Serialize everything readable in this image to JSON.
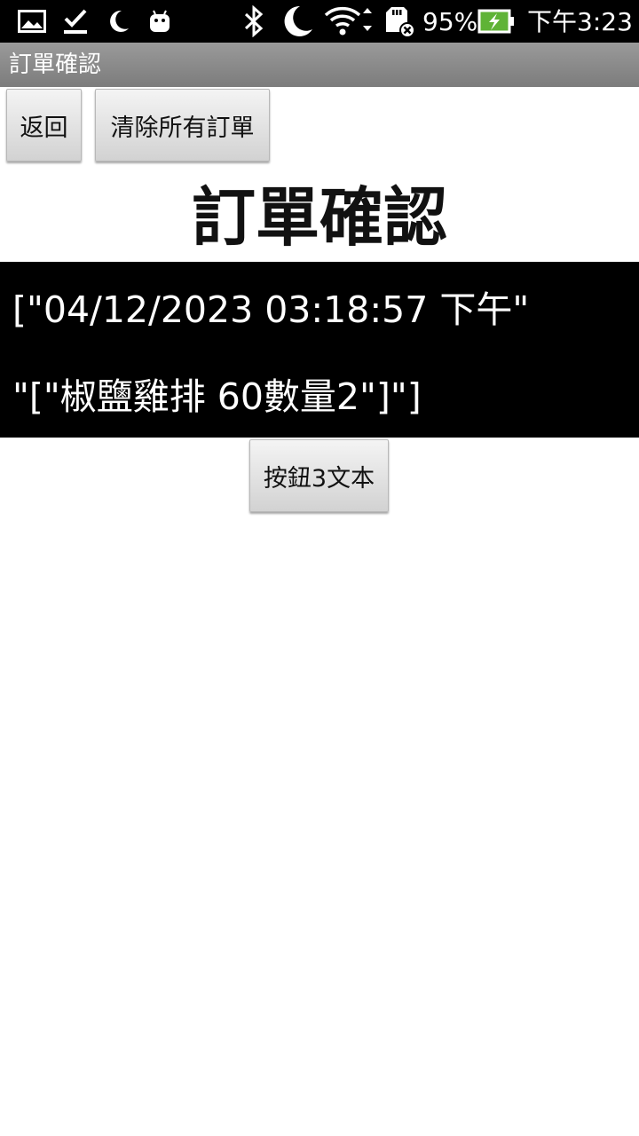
{
  "status_bar": {
    "battery_percent": "95%",
    "time": "下午3:23",
    "icons": [
      "gallery-icon",
      "download-done-icon",
      "moon-icon",
      "android-icon",
      "bluetooth-icon",
      "do-not-disturb-icon",
      "wifi-icon",
      "sd-card-icon",
      "battery-charging-icon"
    ],
    "battery_color": "#5fb336"
  },
  "action_bar": {
    "title": "訂單確認"
  },
  "toolbar": {
    "back_label": "返回",
    "clear_label": "清除所有訂單"
  },
  "page": {
    "title": "訂單確認"
  },
  "order": {
    "line1": "[\"04/12/2023 03:18:57 下午\"",
    "line2": "\"[\"椒鹽雞排 60數量2\"]\"]"
  },
  "bottom": {
    "button3_label": "按鈕3文本"
  }
}
